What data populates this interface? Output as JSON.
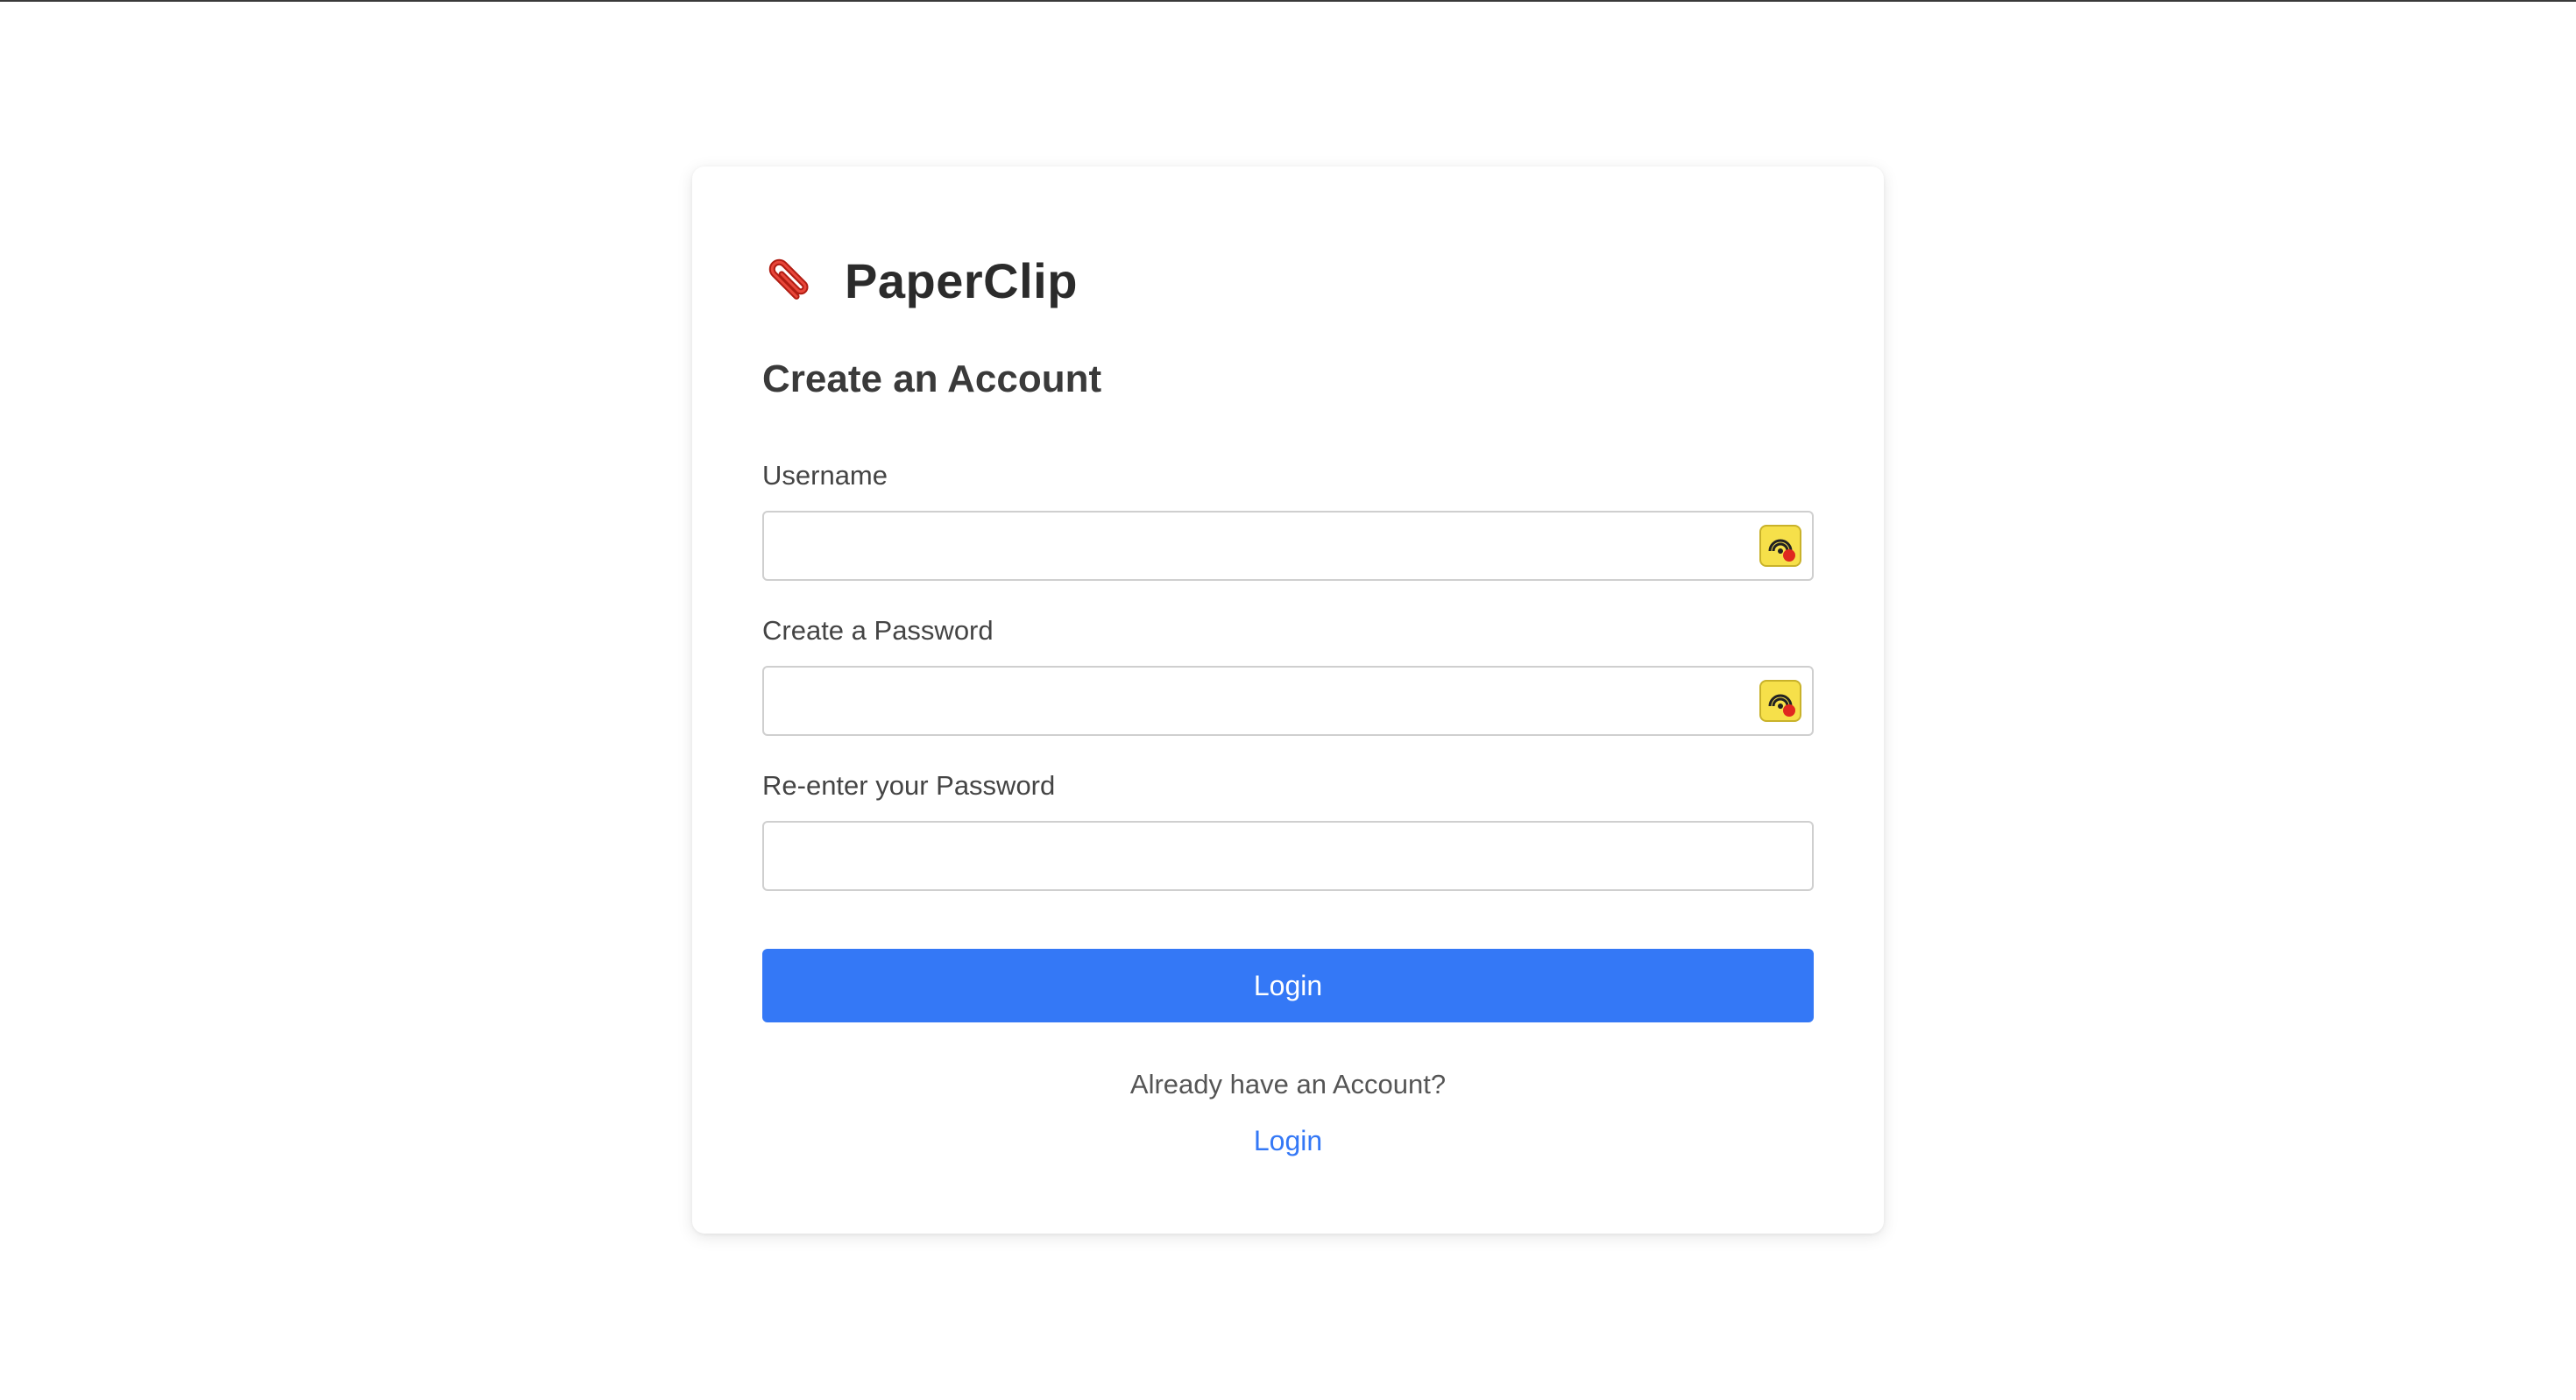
{
  "brand": {
    "name": "PaperClip",
    "icon": "paperclip-icon",
    "icon_color": "#d22a1e"
  },
  "form": {
    "title": "Create an Account",
    "fields": [
      {
        "label": "Username",
        "value": "",
        "placeholder": "",
        "autofill_icon": "password-manager-icon"
      },
      {
        "label": "Create a Password",
        "value": "",
        "placeholder": "",
        "autofill_icon": "password-manager-icon"
      },
      {
        "label": "Re-enter your Password",
        "value": "",
        "placeholder": ""
      }
    ],
    "submit_label": "Login",
    "alt_prompt": "Already have an Account?",
    "alt_link_label": "Login"
  },
  "colors": {
    "accent": "#3478f6",
    "autofill_bg": "#f6e04a",
    "autofill_dot": "#e0281f"
  }
}
